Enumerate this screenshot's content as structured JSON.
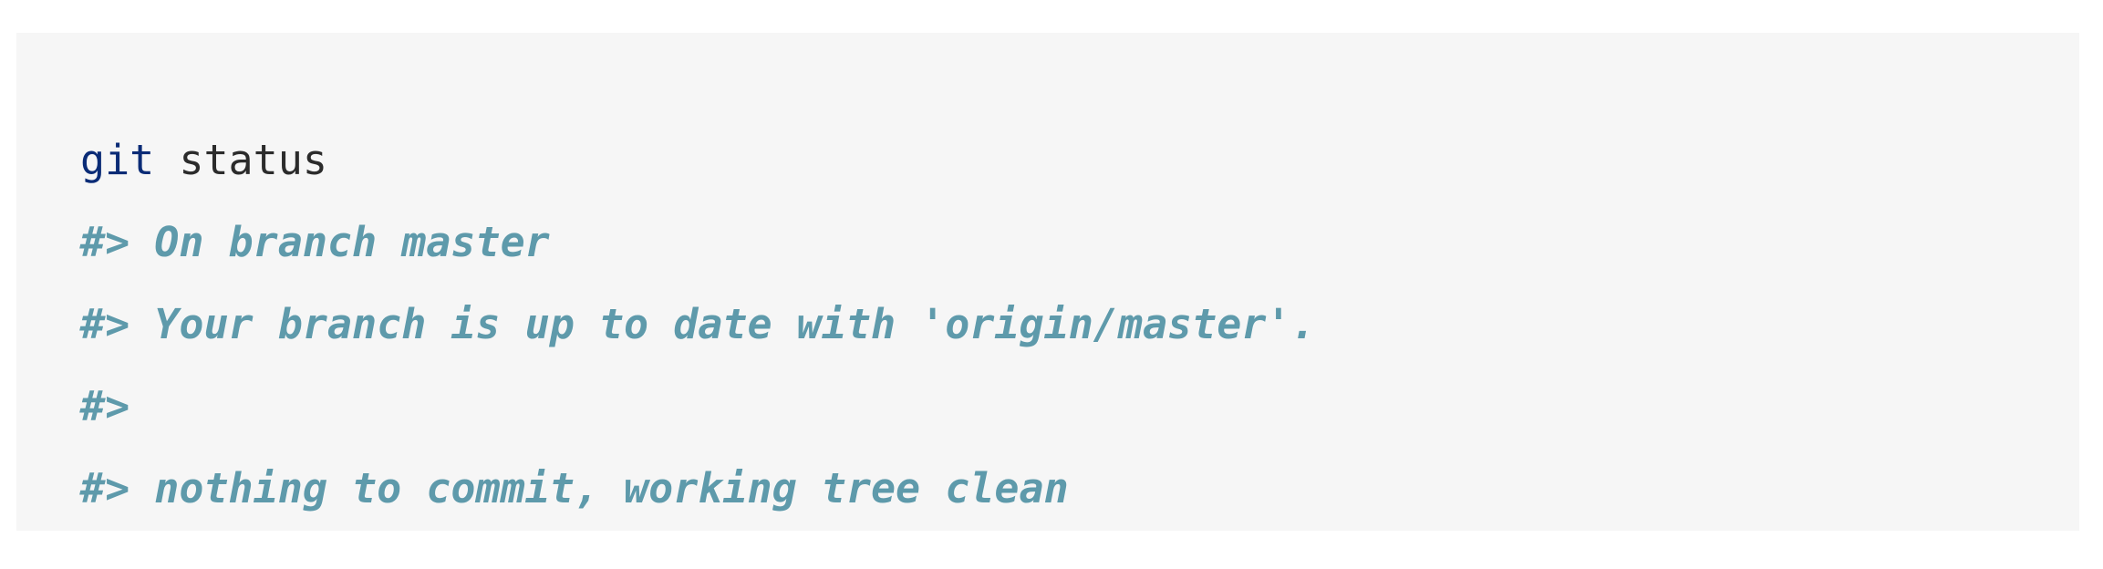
{
  "code": {
    "command": {
      "keyword": "git",
      "args": " status"
    },
    "output": [
      "#> On branch master",
      "#> Your branch is up to date with 'origin/master'.",
      "#>",
      "#> nothing to commit, working tree clean"
    ]
  },
  "colors": {
    "background": "#f6f6f6",
    "keyword": "#0a2b76",
    "text": "#2b2b2b",
    "comment": "#5e9aab"
  }
}
